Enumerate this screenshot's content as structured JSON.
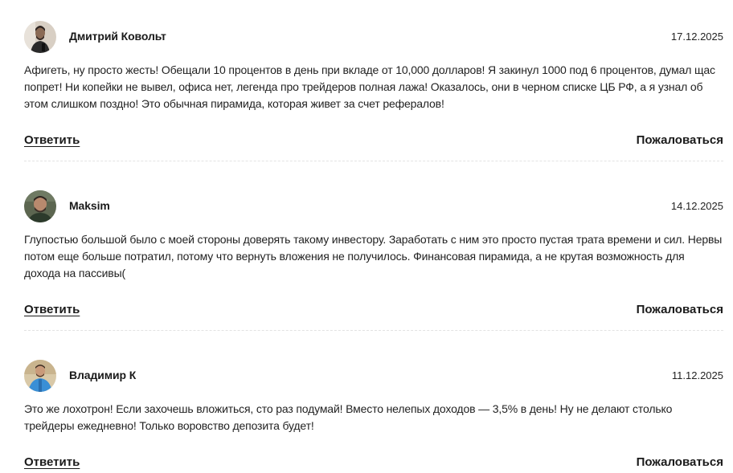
{
  "comments": [
    {
      "author": "Дмитрий Ковольт",
      "date": "17.12.2025",
      "text": "Афигеть, ну просто жесть! Обещали 10 процентов в день при вкладе от 10,000 долларов! Я закинул 1000 под 6 процентов, думал щас попрет! Ни копейки не вывел, офиса нет, легенда про трейдеров полная лажа! Оказалось, они в черном списке ЦБ РФ, а я узнал об этом слишком поздно! Это обычная пирамида, которая живет за счет рефералов!",
      "reply_label": "Ответить",
      "report_label": "Пожаловаться"
    },
    {
      "author": "Maksim",
      "date": "14.12.2025",
      "text": "Глупостью большой было с моей стороны доверять такому инвестору. Заработать с ним это просто пустая трата времени и сил. Нервы потом еще больше потратил, потому что вернуть вложения не получилось. Финансовая пирамида, а не крутая возможность для дохода на пассивы(",
      "reply_label": "Ответить",
      "report_label": "Пожаловаться"
    },
    {
      "author": "Владимир К",
      "date": "11.12.2025",
      "text": "Это же лохотрон! Если захочешь вложиться, сто раз подумай! Вместо нелепых доходов — 3,5% в день! Ну не делают столько трейдеры ежедневно! Только воровство депозита будет!",
      "reply_label": "Ответить",
      "report_label": "Пожаловаться"
    }
  ],
  "colors": {
    "text": "#1a1a1a",
    "divider": "#e3e3e3",
    "avatar_1_bg": "#d8cfc4",
    "avatar_2_bg": "#5c6650",
    "avatar_3_bg": "#3a8fd6"
  }
}
